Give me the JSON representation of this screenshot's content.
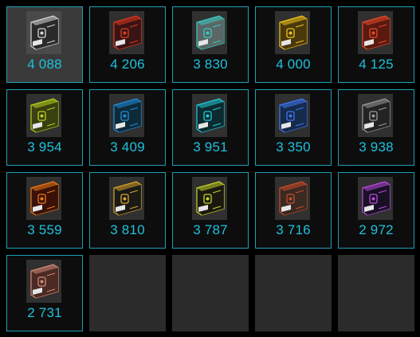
{
  "items": [
    {
      "price": "4 088",
      "icon": "black-case-icon",
      "color": "#2a2a2a",
      "accent": "#d8d8d8",
      "selected": true
    },
    {
      "price": "4 206",
      "icon": "red-flame-case-icon",
      "color": "#3a1414",
      "accent": "#e03a1e"
    },
    {
      "price": "3 830",
      "icon": "teal-metal-crate-icon",
      "color": "#5a6766",
      "accent": "#39c9c0"
    },
    {
      "price": "4 000",
      "icon": "gold-crate-icon",
      "color": "#4a3a0a",
      "accent": "#f2c21f"
    },
    {
      "price": "4 125",
      "icon": "red-metal-crate-icon",
      "color": "#5a1a10",
      "accent": "#e44a2a"
    },
    {
      "price": "3 954",
      "icon": "lime-crate-icon",
      "color": "#3a4010",
      "accent": "#b9d21f"
    },
    {
      "price": "3 409",
      "icon": "blue-striped-case-icon",
      "color": "#0e2a3a",
      "accent": "#1f8fd8"
    },
    {
      "price": "3 951",
      "icon": "cyan-case-icon",
      "color": "#0c2b30",
      "accent": "#26c8d8"
    },
    {
      "price": "3 350",
      "icon": "blue-pattern-crate-icon",
      "color": "#162a4a",
      "accent": "#3f78f0"
    },
    {
      "price": "3 938",
      "icon": "dark-grey-case-icon",
      "color": "#232323",
      "accent": "#9a9a9a"
    },
    {
      "price": "3 559",
      "icon": "lava-crate-icon",
      "color": "#3a1208",
      "accent": "#ef7a18"
    },
    {
      "price": "3 810",
      "icon": "gold-outline-case-icon",
      "color": "#1a1a16",
      "accent": "#d9a62a"
    },
    {
      "price": "3 787",
      "icon": "biohazard-case-icon",
      "color": "#1a1a10",
      "accent": "#c9d62a"
    },
    {
      "price": "3 716",
      "icon": "rusty-case-icon",
      "color": "#3a2a24",
      "accent": "#cc4a2a"
    },
    {
      "price": "2 972",
      "icon": "purple-case-icon",
      "color": "#1a1224",
      "accent": "#b84ae0"
    },
    {
      "price": "2 731",
      "icon": "copper-crate-icon",
      "color": "#4a2a24",
      "accent": "#d28a78"
    }
  ],
  "empty_slots": 4
}
